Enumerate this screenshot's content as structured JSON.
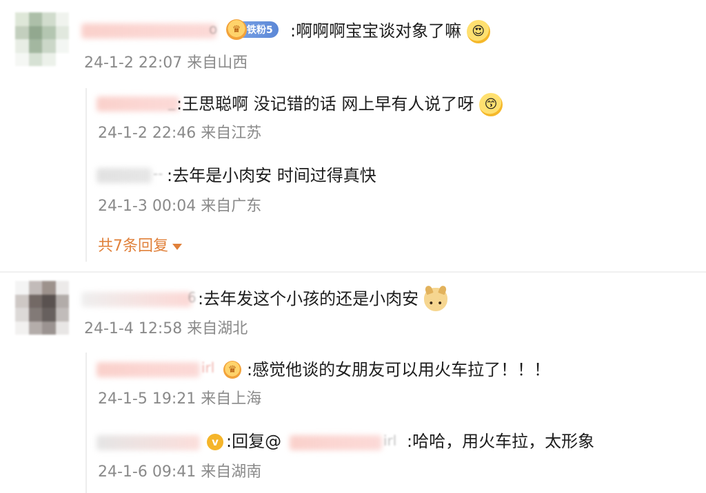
{
  "comments": [
    {
      "name_tail": "o",
      "badge": {
        "label": "铁粉5"
      },
      "text": ":啊啊啊宝宝谈对象了嘛",
      "emoji": "heart-eyes-emoji",
      "meta": "24-1-2 22:07 来自山西",
      "replies": [
        {
          "name_tail": "_",
          "text": ":王思聪啊 没记错的话 网上早有人说了呀",
          "emoji": "kiss-emoji",
          "meta": "24-1-2 22:46 来自江苏"
        },
        {
          "name_tail": "--",
          "text": ":去年是小肉安 时间过得真快",
          "meta": "24-1-3 00:04 来自广东"
        }
      ],
      "more_replies": "共7条回复"
    },
    {
      "name_tail": "6",
      "text": ":去年发这个小孩的还是小肉安",
      "emoji": "doge-emoji",
      "meta": "24-1-4 12:58 来自湖北",
      "replies": [
        {
          "name_tail": "irl",
          "text": ":感觉他谈的女朋友可以用火车拉了！！！",
          "meta": "24-1-5 19:21 来自上海"
        },
        {
          "name_tail": "",
          "mention_prefix": ":回复@",
          "mention_tail": "irl",
          "text": ":哈哈，用火车拉，太形象",
          "meta": "24-1-6 09:41 来自湖南"
        }
      ]
    }
  ],
  "colors": {
    "more_link": "#e0803a",
    "meta": "#8a8a8a",
    "fan_badge": "#5b87d6"
  }
}
